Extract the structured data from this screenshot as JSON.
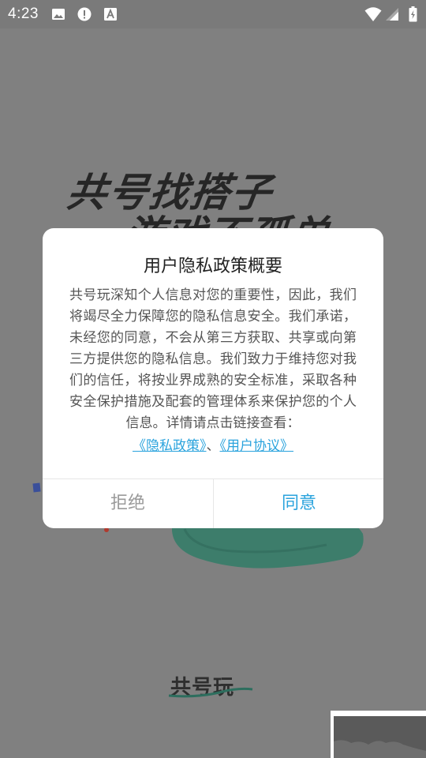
{
  "status_bar": {
    "time": "4:23",
    "icons": [
      "image-icon",
      "alert-icon",
      "font-icon",
      "wifi-icon",
      "signal-icon",
      "battery-icon"
    ]
  },
  "splash": {
    "headline_line1": "共号找搭子",
    "headline_line2": "游戏不孤单",
    "logo_text": "共号玩",
    "accent_color": "#3aa78c"
  },
  "dialog": {
    "title": "用户隐私政策概要",
    "body": "共号玩深知个人信息对您的重要性，因此，我们将竭尽全力保障您的隐私信息安全。我们承诺，未经您的同意，不会从第三方获取、共享或向第三方提供您的隐私信息。我们致力于维持您对我们的信任，将按业界成熟的安全标准，采取各种安全保护措施及配套的管理体系来保护您的个人信息。详情请点击链接查看：",
    "privacy_link": "《隐私政策》",
    "separator": "、",
    "agreement_link": "《用户协议》",
    "reject_label": "拒绝",
    "agree_label": "同意",
    "link_color": "#2aa3dd"
  }
}
